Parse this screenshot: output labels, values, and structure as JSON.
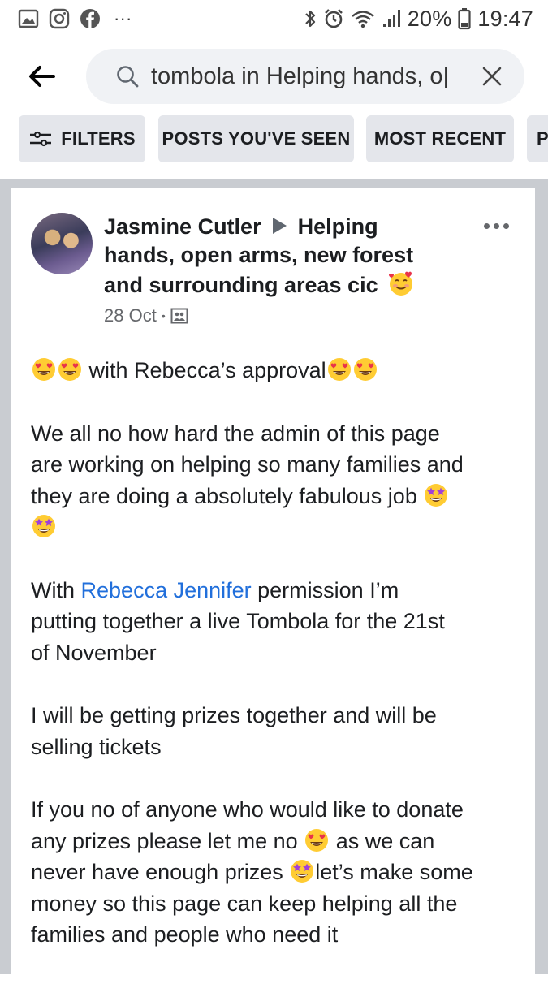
{
  "status_bar": {
    "battery": "20%",
    "time": "19:47",
    "more": "···"
  },
  "search": {
    "query": "tombola in Helping hands, o|",
    "placeholder": "Search"
  },
  "filters": {
    "filters_label": "FILTERS",
    "seen_label": "POSTS YOU'VE SEEN",
    "recent_label": "MOST RECENT",
    "more_label": "P"
  },
  "post": {
    "author": "Jasmine Cutler",
    "group": "Helping hands, open arms, new forest and surrounding areas cic",
    "header_line1_group": "Helping",
    "header_line2": "hands, open arms, new forest",
    "header_line3": "and surrounding areas cic",
    "date": "28 Oct",
    "date_separator": "•",
    "body": {
      "p1": " with Rebecca’s approval",
      "p2_l1": "We all no how hard the admin of this page",
      "p2_l2": "are working on helping so many families and",
      "p2_l3": "they are doing a absolutely fabulous job ",
      "p3_l1_pre": "With ",
      "p3_mention": "Rebecca Jennifer",
      "p3_l1_post": " permission I’m",
      "p3_l2": "putting together a live Tombola for the 21st",
      "p3_l3": "of November",
      "p4_l1": "I will be getting prizes together and will be",
      "p4_l2": "selling tickets",
      "p5_l1": "If you no of anyone who would like to donate",
      "p5_l2_pre": "any prizes please let me no ",
      "p5_l2_post": "  as we can",
      "p5_l3_pre": "never have enough prizes ",
      "p5_l3_post": "let’s make some",
      "p5_l4": "money so this page can keep helping all the",
      "p5_l5": "families and people who need it"
    }
  },
  "colors": {
    "mention": "#216fdb",
    "chip_bg": "#e4e6eb",
    "feed_bg": "#c9ccd1",
    "search_bg": "#f0f2f5"
  },
  "icons": [
    "gallery-icon",
    "instagram-icon",
    "facebook-icon",
    "bluetooth-icon",
    "alarm-icon",
    "wifi-icon",
    "signal-icon",
    "battery-icon",
    "back-arrow-icon",
    "search-icon",
    "close-icon",
    "filter-sliders-icon",
    "triangle-right-icon",
    "group-privacy-icon",
    "more-dots-icon",
    "heart-eyes-emoji",
    "star-struck-emoji",
    "smiling-hearts-emoji"
  ]
}
